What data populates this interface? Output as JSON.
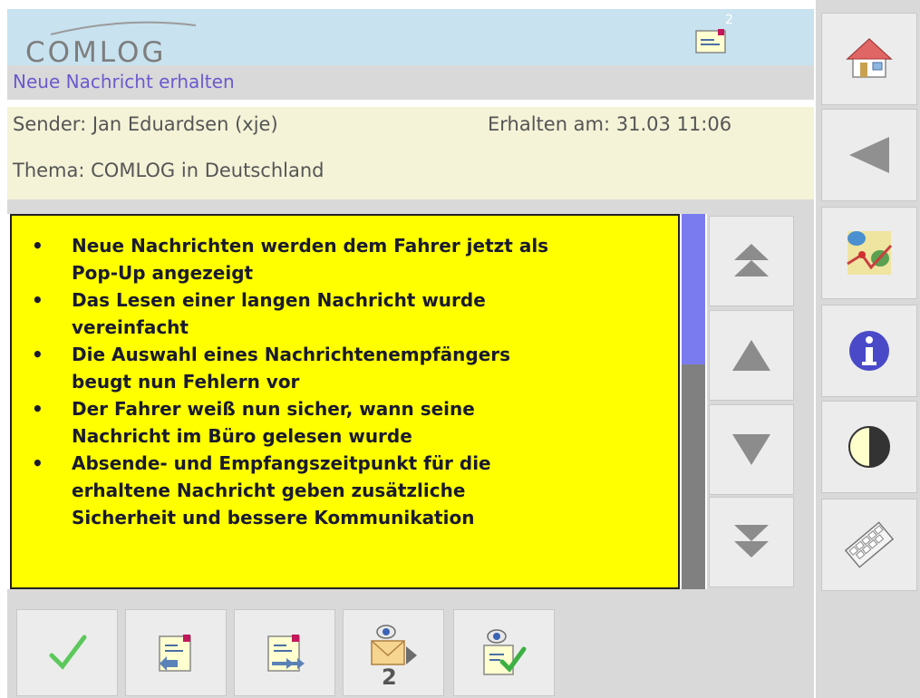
{
  "header": {
    "logo_text": "COMLOG",
    "message_count": "2",
    "status": "Neue Nachricht erhalten"
  },
  "info": {
    "sender": "Sender: Jan Eduardsen (xje)",
    "received": "Erhalten am: 31.03 11:06",
    "topic": "Thema: COMLOG in Deutschland"
  },
  "message": {
    "items": [
      [
        "Neue Nachrichten werden dem Fahrer jetzt als",
        "Pop-Up angezeigt"
      ],
      [
        "Das Lesen einer langen Nachricht wurde",
        "vereinfacht"
      ],
      [
        "Die Auswahl eines Nachrichtenempfängers",
        "beugt nun Fehlern vor"
      ],
      [
        "Der Fahrer weiß nun sicher, wann seine",
        "Nachricht im Büro gelesen wurde"
      ],
      [
        "Absende- und Empfangszeitpunkt für die",
        "erhaltene Nachricht geben zusätzliche",
        "Sicherheit und bessere Kommunikation"
      ]
    ]
  },
  "scroll": {
    "thumb_fraction": 0.4
  },
  "toolbar": {
    "read_receipt_count": "2"
  },
  "icons": {
    "home": "home-icon",
    "back": "back-arrow-icon",
    "map": "map-icon",
    "info": "info-icon",
    "contrast": "contrast-icon",
    "keyboard": "keyboard-icon",
    "page_up": "double-up-arrow-icon",
    "line_up": "up-arrow-icon",
    "line_down": "down-arrow-icon",
    "page_down": "double-down-arrow-icon",
    "confirm": "checkmark-icon",
    "reply": "reply-message-icon",
    "forward": "forward-message-icon",
    "read_receipt": "read-receipt-icon",
    "mark_read": "mark-read-icon"
  },
  "colors": {
    "header_bg": "#c8e2ef",
    "message_bg": "#ffff00",
    "scroll_thumb": "#7b7bf0",
    "status_text": "#6a5acd",
    "info_bg": "#f4f3d8"
  }
}
